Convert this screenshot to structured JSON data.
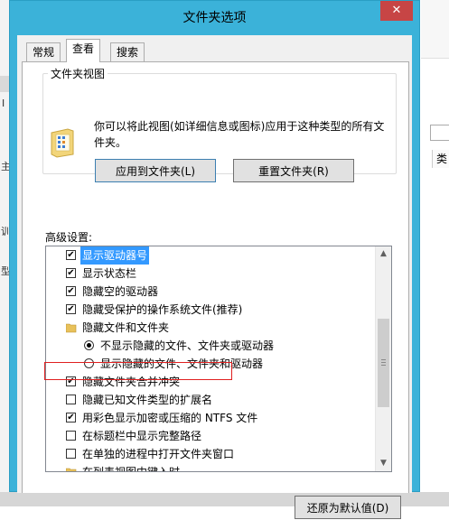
{
  "dialog": {
    "title": "文件夹选项",
    "close_glyph": "✕",
    "tabs": [
      {
        "label": "常规"
      },
      {
        "label": "查看"
      },
      {
        "label": "搜索"
      }
    ]
  },
  "folder_views": {
    "group_label": "文件夹视图",
    "description": "你可以将此视图(如详细信息或图标)应用于这种类型的所有文件夹。",
    "apply_button": "应用到文件夹(L)",
    "reset_button": "重置文件夹(R)"
  },
  "advanced": {
    "label": "高级设置:",
    "items": [
      {
        "type": "checkbox",
        "checked": true,
        "indent": 0,
        "label": "显示驱动器号"
      },
      {
        "type": "checkbox",
        "checked": true,
        "indent": 0,
        "label": "显示状态栏"
      },
      {
        "type": "checkbox",
        "checked": true,
        "indent": 0,
        "label": "隐藏空的驱动器"
      },
      {
        "type": "checkbox",
        "checked": true,
        "indent": 0,
        "label": "隐藏受保护的操作系统文件(推荐)"
      },
      {
        "type": "folder",
        "checked": false,
        "indent": 0,
        "label": "隐藏文件和文件夹"
      },
      {
        "type": "radio",
        "checked": true,
        "indent": 1,
        "label": "不显示隐藏的文件、文件夹或驱动器"
      },
      {
        "type": "radio",
        "checked": false,
        "indent": 1,
        "label": "显示隐藏的文件、文件夹和驱动器"
      },
      {
        "type": "checkbox",
        "checked": true,
        "indent": 0,
        "label": "隐藏文件夹合并冲突"
      },
      {
        "type": "checkbox",
        "checked": false,
        "indent": 0,
        "label": "隐藏已知文件类型的扩展名"
      },
      {
        "type": "checkbox",
        "checked": true,
        "indent": 0,
        "label": "用彩色显示加密或压缩的 NTFS 文件"
      },
      {
        "type": "checkbox",
        "checked": false,
        "indent": 0,
        "label": "在标题栏中显示完整路径"
      },
      {
        "type": "checkbox",
        "checked": false,
        "indent": 0,
        "label": "在单独的进程中打开文件夹窗口"
      },
      {
        "type": "folder",
        "checked": false,
        "indent": 0,
        "label": "在列表视图中键入时"
      }
    ],
    "restore_button": "还原为默认值(D)"
  },
  "background": {
    "right_header": "类",
    "left_glyphs": [
      "I",
      "主",
      "训",
      "型"
    ]
  },
  "colors": {
    "title_bar": "#3bb2d9",
    "close_button": "#c74545",
    "selection": "#3399ff",
    "highlight_box": "#e02020"
  }
}
